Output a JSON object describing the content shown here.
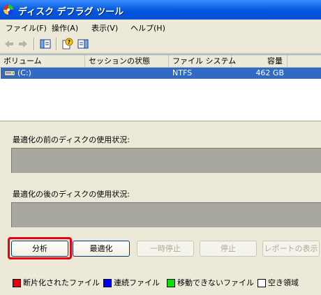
{
  "window": {
    "title": "ディスク デフラグ ツール"
  },
  "menu": [
    "ファイル(F)",
    "操作(A)",
    "表示(V)",
    "ヘルプ(H)"
  ],
  "listview": {
    "columns": [
      "ボリューム",
      "セッションの状態",
      "ファイル システム",
      "容量"
    ],
    "rows": [
      {
        "volume": "(C:)",
        "status": "",
        "filesystem": "NTFS",
        "capacity": "462 GB"
      }
    ]
  },
  "usage": {
    "before_label": "最適化の前のディスクの使用状況:",
    "after_label": "最適化の後のディスクの使用状況:"
  },
  "buttons": {
    "analyze": "分析",
    "defragment": "最適化",
    "pause": "一時停止",
    "stop": "停止",
    "report": "レポートの表示"
  },
  "legend": [
    {
      "label": "断片化されたファイル",
      "color": "#e8000b"
    },
    {
      "label": "連続ファイル",
      "color": "#0000ff"
    },
    {
      "label": "移動できないファイル",
      "color": "#00e600"
    },
    {
      "label": "空き領域",
      "color": "#ffffff"
    }
  ]
}
